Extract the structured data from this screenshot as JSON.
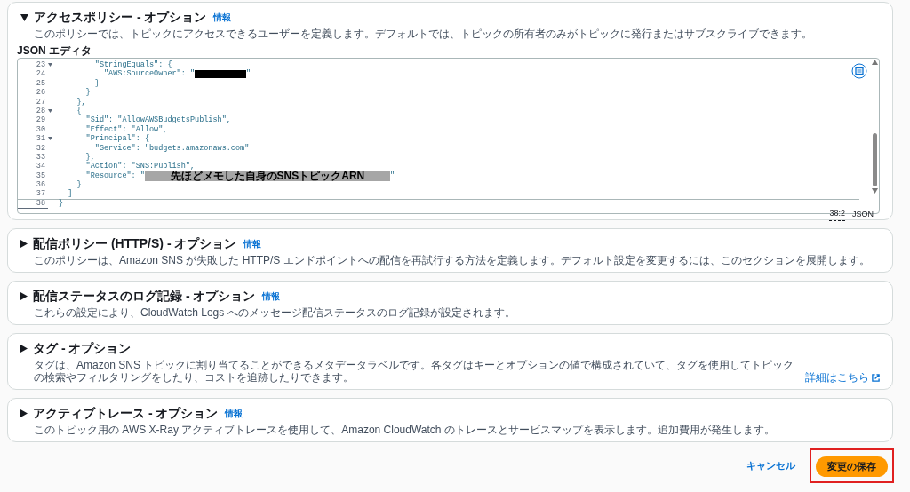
{
  "sections": [
    {
      "title": "アクセスポリシー - オプション",
      "info": "情報",
      "expanded": true,
      "description": "このポリシーでは、トピックにアクセスできるユーザーを定義します。デフォルトでは、トピックの所有者のみがトピックに発行またはサブスクライブできます。",
      "editor": {
        "label": "JSON エディタ",
        "cursor": "38:2",
        "mode": "JSON",
        "lines": [
          {
            "number": "23",
            "fold": true,
            "current": false,
            "segments": [
              {
                "kind": "code",
                "text": "        \"StringEquals\": {"
              }
            ]
          },
          {
            "number": "24",
            "fold": false,
            "current": false,
            "segments": [
              {
                "kind": "code",
                "text": "          \"AWS:SourceOwner\": \""
              },
              {
                "kind": "redacted"
              },
              {
                "kind": "code",
                "text": "\""
              }
            ]
          },
          {
            "number": "25",
            "fold": false,
            "current": false,
            "segments": [
              {
                "kind": "code",
                "text": "        }"
              }
            ]
          },
          {
            "number": "26",
            "fold": false,
            "current": false,
            "segments": [
              {
                "kind": "code",
                "text": "      }"
              }
            ]
          },
          {
            "number": "27",
            "fold": false,
            "current": false,
            "segments": [
              {
                "kind": "code",
                "text": "    },"
              }
            ]
          },
          {
            "number": "28",
            "fold": true,
            "current": false,
            "segments": [
              {
                "kind": "code",
                "text": "    {"
              }
            ]
          },
          {
            "number": "29",
            "fold": false,
            "current": false,
            "segments": [
              {
                "kind": "code",
                "text": "      \"Sid\": \"AllowAWSBudgetsPublish\","
              }
            ]
          },
          {
            "number": "30",
            "fold": false,
            "current": false,
            "segments": [
              {
                "kind": "code",
                "text": "      \"Effect\": \"Allow\","
              }
            ]
          },
          {
            "number": "31",
            "fold": true,
            "current": false,
            "segments": [
              {
                "kind": "code",
                "text": "      \"Principal\": {"
              }
            ]
          },
          {
            "number": "32",
            "fold": false,
            "current": false,
            "segments": [
              {
                "kind": "code",
                "text": "        \"Service\": \"budgets.amazonaws.com\""
              }
            ]
          },
          {
            "number": "33",
            "fold": false,
            "current": false,
            "segments": [
              {
                "kind": "code",
                "text": "      },"
              }
            ]
          },
          {
            "number": "34",
            "fold": false,
            "current": false,
            "segments": [
              {
                "kind": "code",
                "text": "      \"Action\": \"SNS:Publish\","
              }
            ]
          },
          {
            "number": "35",
            "fold": false,
            "current": false,
            "segments": [
              {
                "kind": "code",
                "text": "      \"Resource\": \""
              },
              {
                "kind": "note",
                "text": "先ほどメモした自身のSNSトピックARN"
              },
              {
                "kind": "code",
                "text": "\""
              }
            ]
          },
          {
            "number": "36",
            "fold": false,
            "current": false,
            "segments": [
              {
                "kind": "code",
                "text": "    }"
              }
            ]
          },
          {
            "number": "37",
            "fold": false,
            "current": false,
            "segments": [
              {
                "kind": "code",
                "text": "  ]"
              }
            ]
          },
          {
            "number": "38",
            "fold": false,
            "current": true,
            "segments": [
              {
                "kind": "code",
                "text": "}"
              }
            ]
          }
        ]
      }
    },
    {
      "title": "配信ポリシー (HTTP/S) - オプション",
      "info": "情報",
      "expanded": false,
      "description": "このポリシーは、Amazon SNS が失敗した HTTP/S エンドポイントへの配信を再試行する方法を定義します。デフォルト設定を変更するには、このセクションを展開します。"
    },
    {
      "title": "配信ステータスのログ記録 - オプション",
      "info": "情報",
      "expanded": false,
      "description": "これらの設定により、CloudWatch Logs へのメッセージ配信ステータスのログ記録が設定されます。"
    },
    {
      "title": "タグ - オプション",
      "expanded": false,
      "description": "タグは、Amazon SNS トピックに割り当てることができるメタデータラベルです。各タグはキーとオプションの値で構成されていて、タグを使用してトピックの検索やフィルタリングをしたり、コストを追跡したりできます。",
      "link": "詳細はこちら"
    },
    {
      "title": "アクティブトレース - オプション",
      "info": "情報",
      "expanded": false,
      "description": "このトピック用の AWS X-Ray アクティブトレースを使用して、Amazon CloudWatch のトレースとサービスマップを表示します。追加費用が発生します。"
    }
  ],
  "actions": {
    "cancel": "キャンセル",
    "save": "変更の保存",
    "save_highlighted": true
  }
}
